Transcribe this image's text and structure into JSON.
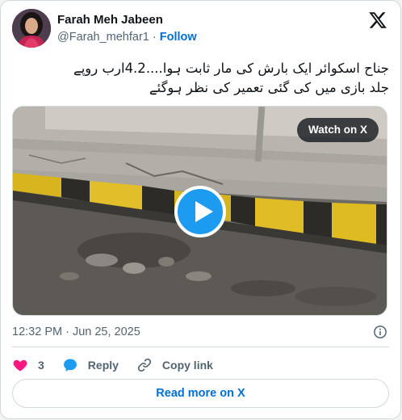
{
  "author": {
    "name": "Farah Meh Jabeen",
    "handle": "@Farah_mehfar1",
    "separator": "·",
    "follow_label": "Follow"
  },
  "tweet": {
    "text_line1": "جناح اسکوائر ایک بارش کی مار ثابت ہوا....4.2ارب روپے",
    "text_line2": "جلد بازی میں کی گئی تعمیر کی نظر ہوگئے"
  },
  "media": {
    "watch_label": "Watch on X",
    "play_icon": "play-icon"
  },
  "meta": {
    "timestamp": "12:32 PM · Jun 25, 2025",
    "info_icon": "info-icon"
  },
  "actions": {
    "like_count": "3",
    "reply_label": "Reply",
    "copy_label": "Copy link"
  },
  "footer": {
    "read_more_label": "Read more on X"
  },
  "colors": {
    "link_blue": "#006fd6",
    "play_blue": "#1d9bf0",
    "heart_red": "#f91880",
    "reply_blue": "#1d9bf0",
    "muted_text": "#536471",
    "border": "#cfd9de"
  }
}
